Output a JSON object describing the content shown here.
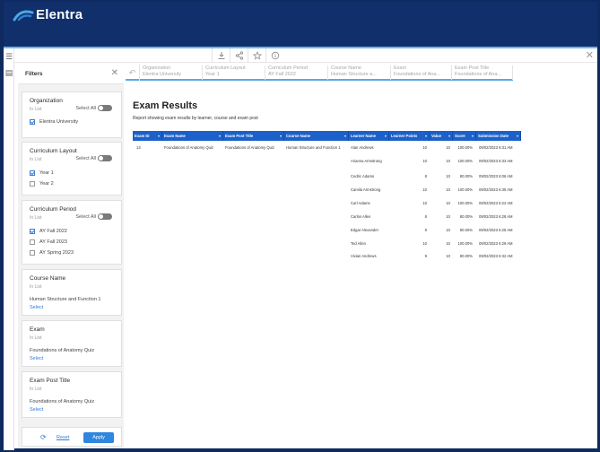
{
  "brand": {
    "name": "Elentra"
  },
  "toolbar": {
    "icons": [
      "download-icon",
      "share-icon",
      "star-icon",
      "info-icon"
    ],
    "close": "✕"
  },
  "filters": {
    "title": "Filters",
    "reset_label": "Reset",
    "apply_label": "Apply",
    "cards": [
      {
        "title": "Organization",
        "sub": "In List",
        "select_all": "Select All",
        "options": [
          {
            "label": "Elentra University",
            "checked": true
          }
        ]
      },
      {
        "title": "Curriculum Layout",
        "sub": "In List",
        "select_all": "Select All",
        "options": [
          {
            "label": "Year 1",
            "checked": true
          },
          {
            "label": "Year 2",
            "checked": false
          }
        ]
      },
      {
        "title": "Curriculum Period",
        "sub": "In List",
        "select_all": "Select All",
        "options": [
          {
            "label": "AY Fall 2022",
            "checked": true
          },
          {
            "label": "AY Fall 2023",
            "checked": false
          },
          {
            "label": "AY Spring 2023",
            "checked": false
          }
        ]
      },
      {
        "title": "Course Name",
        "sub": "In List",
        "value": "Human Structure and Function 1",
        "select_label": "Select"
      },
      {
        "title": "Exam",
        "sub": "In List",
        "value": "Foundations of Anatomy Quiz",
        "select_label": "Select"
      },
      {
        "title": "Exam Post Title",
        "sub": "In List",
        "value": "Foundations of Anatomy Quiz",
        "select_label": "Select"
      }
    ]
  },
  "breadcrumbs": [
    {
      "key": "Organization",
      "value": "Elentra University"
    },
    {
      "key": "Curriculum Layout",
      "value": "Year 1"
    },
    {
      "key": "Curriculum Period",
      "value": "AY Fall 2022"
    },
    {
      "key": "Course Name",
      "value": "Human Structure a..."
    },
    {
      "key": "Exam",
      "value": "Foundations of Ana..."
    },
    {
      "key": "Exam Post Title",
      "value": "Foundations of Ana..."
    }
  ],
  "report": {
    "title": "Exam Results",
    "subtitle": "Report showing exam results by learner, course and exam post"
  },
  "table": {
    "columns": [
      "Exam ID",
      "Exam Name",
      "Exam Post Title",
      "Course Name",
      "Learner Name",
      "Learner Points",
      "Value",
      "Score",
      "Submission Date"
    ],
    "context": {
      "exam_id": "13",
      "exam_name": "Foundations of Anatomy Quiz",
      "post_title": "Foundations of Anatomy Quiz",
      "course_name": "Human Structure and Function 1"
    },
    "rows": [
      {
        "learner": "Alan Andrews",
        "points": "10",
        "value": "10",
        "score": "100.00%",
        "date": "09/02/2023 6:31 AM"
      },
      {
        "learner": "Arianna Armstrong",
        "points": "10",
        "value": "10",
        "score": "100.00%",
        "date": "09/02/2023 6:33 AM"
      },
      {
        "learner": "Cedric Adams",
        "points": "8",
        "value": "10",
        "score": "80.00%",
        "date": "09/02/2023 6:06 AM"
      },
      {
        "learner": "Camila Armstrong",
        "points": "10",
        "value": "10",
        "score": "100.00%",
        "date": "09/02/2023 6:35 AM"
      },
      {
        "learner": "Carl Adams",
        "points": "10",
        "value": "10",
        "score": "100.00%",
        "date": "09/02/2023 6:22 AM"
      },
      {
        "learner": "Carlos Allen",
        "points": "8",
        "value": "10",
        "score": "80.00%",
        "date": "09/02/2023 6:28 AM"
      },
      {
        "learner": "Edgar Alexander",
        "points": "9",
        "value": "10",
        "score": "90.00%",
        "date": "09/02/2023 6:25 AM"
      },
      {
        "learner": "Ted Allen",
        "points": "10",
        "value": "10",
        "score": "100.00%",
        "date": "09/02/2023 6:29 AM"
      },
      {
        "learner": "Vivian Andrews",
        "points": "9",
        "value": "10",
        "score": "90.00%",
        "date": "09/02/2023 6:32 AM"
      }
    ]
  },
  "colors": {
    "header_bg": "#102f6b",
    "table_head": "#1b61c9",
    "accent": "#2f86de",
    "link": "#2f7ad6"
  }
}
